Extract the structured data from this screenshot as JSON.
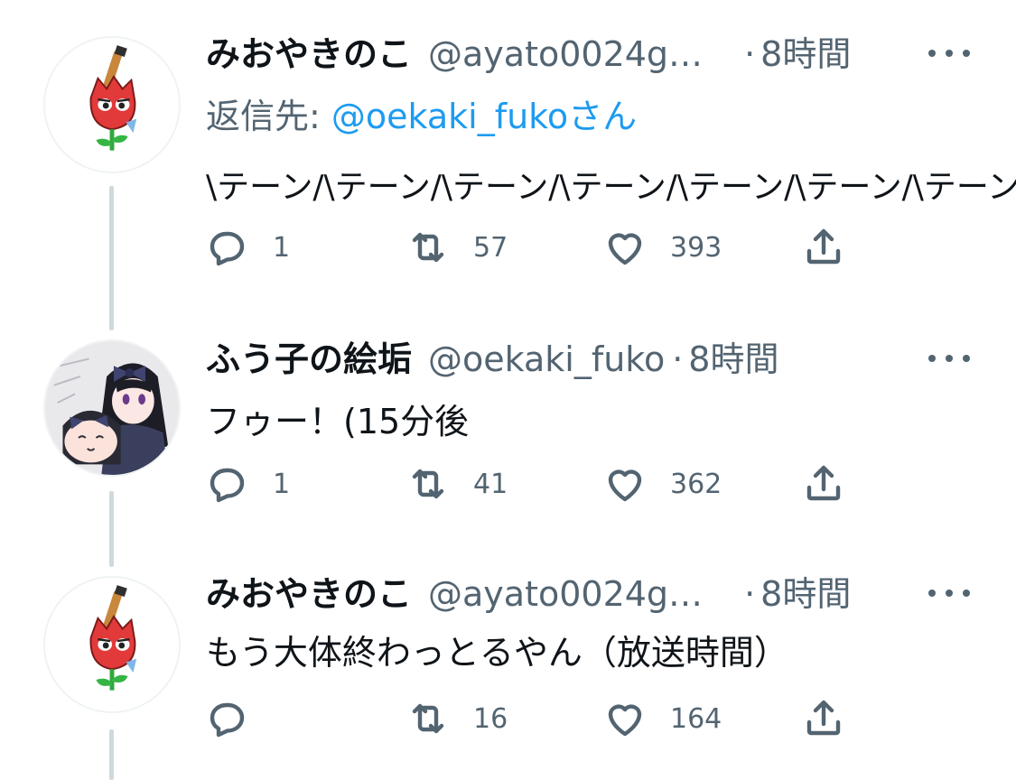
{
  "tweets": [
    {
      "name": "みおやきのこ",
      "handle": "@ayato0024g…",
      "dot": "·",
      "time": "8時間",
      "reply_prefix": "返信先: ",
      "reply_mention": "@oekaki_fukoさん",
      "text": "\\テーン/\\テーン/\\テーン/\\テーン/\\テーン/\\テーン/\\テーン/…",
      "reply_count": "1",
      "retweet_count": "57",
      "like_count": "393",
      "avatar_icon": "tulip-character-icon"
    },
    {
      "name": "ふう子の絵垢",
      "handle": "@oekaki_fuko",
      "dot": "·",
      "time": "8時間",
      "text": "フゥー！(15分後",
      "reply_count": "1",
      "retweet_count": "41",
      "like_count": "362",
      "avatar_icon": "anime-girl-avatar"
    },
    {
      "name": "みおやきのこ",
      "handle": "@ayato0024g…",
      "dot": "·",
      "time": "8時間",
      "text": "もう大体終わっとるやん（放送時間）",
      "reply_count": "",
      "retweet_count": "16",
      "like_count": "164",
      "avatar_icon": "tulip-character-icon"
    }
  ],
  "colors": {
    "text": "#0f1419",
    "secondary": "#536471",
    "link": "#1d9bf0",
    "thread_line": "#cfd9de"
  }
}
